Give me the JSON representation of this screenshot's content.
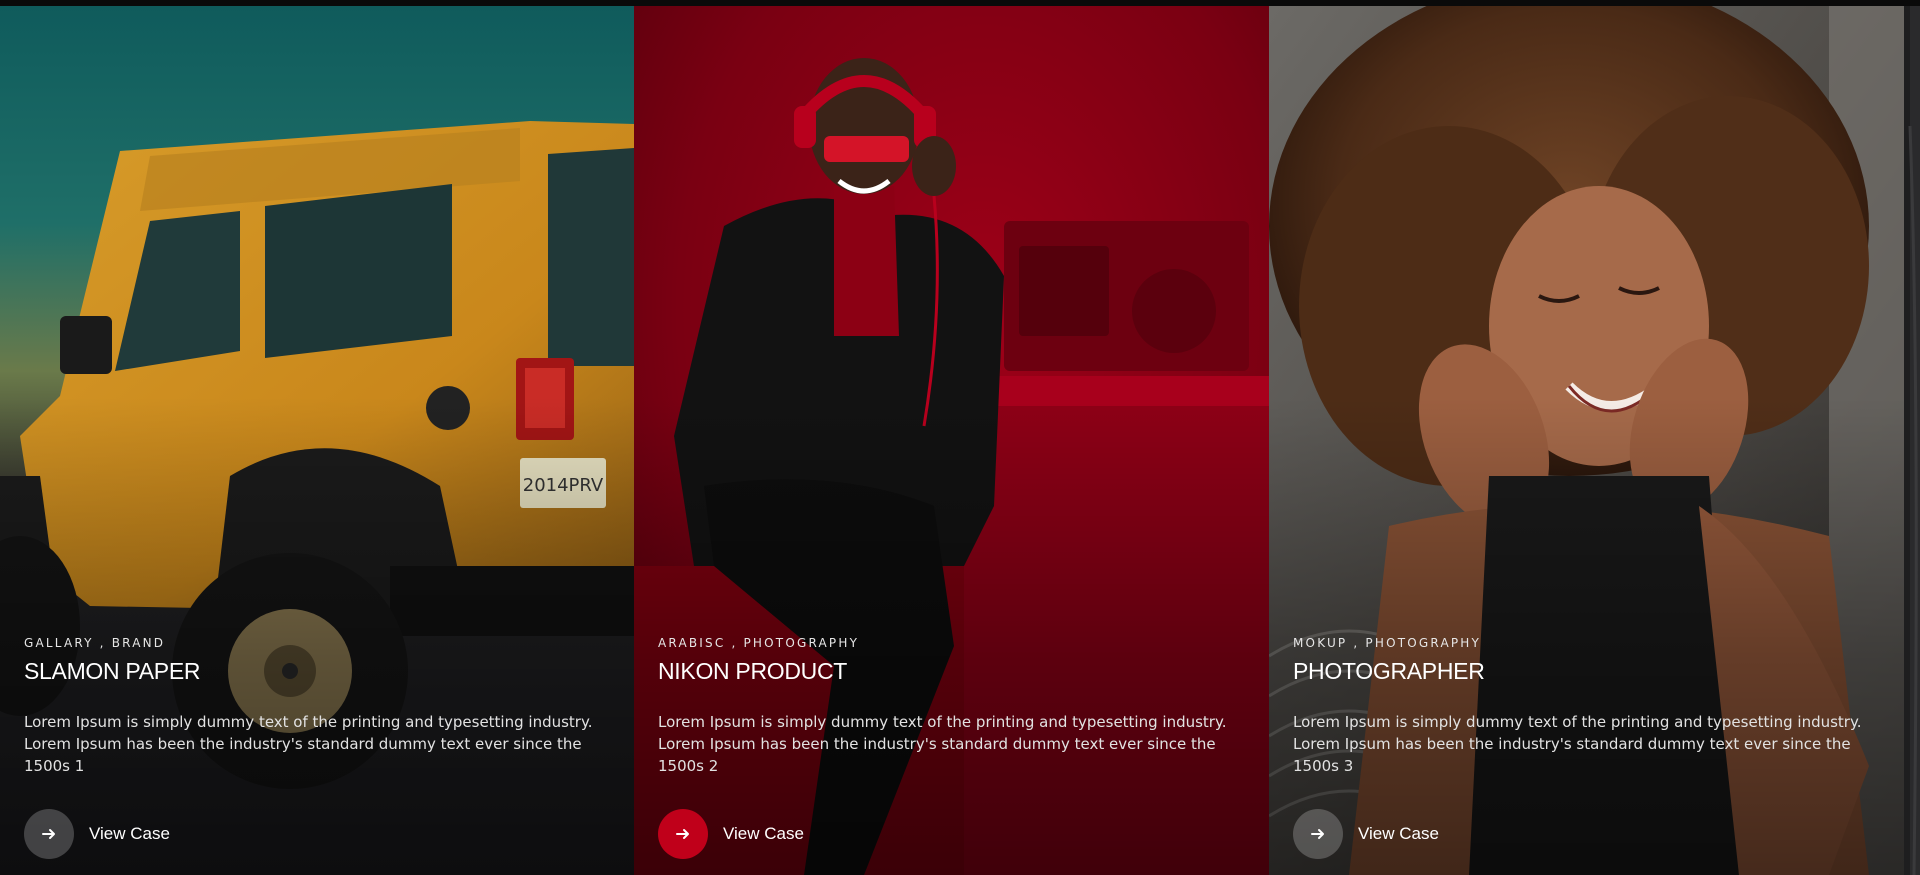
{
  "cards": [
    {
      "tags": "GALLARY , BRAND",
      "title": "SLAMON PAPER",
      "description": "Lorem Ipsum is simply dummy text of the printing and typesetting industry. Lorem Ipsum has been the industry's standard dummy text ever since the 1500s 1",
      "cta_label": "View Case",
      "cta_icon": "arrow-right-icon",
      "image_subject": "jeep-photo"
    },
    {
      "tags": "ARABISC , PHOTOGRAPHY",
      "title": "NIKON PRODUCT",
      "description": "Lorem Ipsum is simply dummy text of the printing and typesetting industry. Lorem Ipsum has been the industry's standard dummy text ever since the 1500s 2",
      "cta_label": "View Case",
      "cta_icon": "arrow-right-icon",
      "image_subject": "red-studio-portrait-photo"
    },
    {
      "tags": "MOKUP , PHOTOGRAPHY",
      "title": "PHOTOGRAPHER",
      "description": "Lorem Ipsum is simply dummy text of the printing and typesetting industry. Lorem Ipsum has been the industry's standard dummy text ever since the 1500s 3",
      "cta_label": "View Case",
      "cta_icon": "arrow-right-icon",
      "image_subject": "smiling-woman-portrait-photo"
    }
  ],
  "colors": {
    "accent": "#c0001a",
    "page_background": "#0d0d0d",
    "text": "#ffffff"
  }
}
